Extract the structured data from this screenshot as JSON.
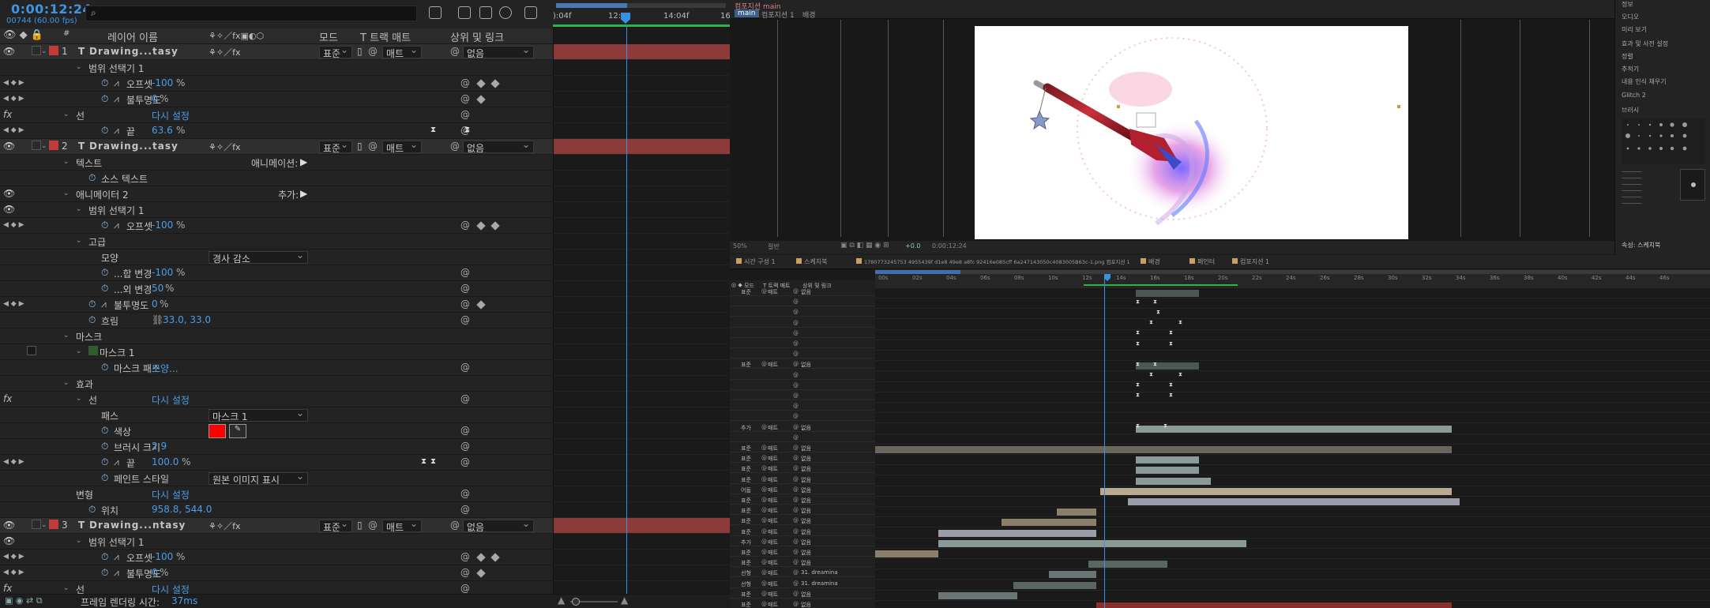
{
  "left": {
    "timecode": "0:00:12:24",
    "fps": "00744 (60.00 fps)",
    "search_placeholder": "",
    "headers": {
      "layer_name": "레이어 이름",
      "mode": "모드",
      "track": "T  트랙 매트",
      "parent": "상위 및 링크"
    },
    "ruler": [
      "):04f",
      "12:04",
      "14:04f",
      "16"
    ],
    "footer_label": "프레임 렌더링 시간:",
    "footer_value": "37ms",
    "rows": [
      {
        "type": "layer",
        "num": "1",
        "name": "Drawing...tasy",
        "mode": "표준",
        "matte": "매트",
        "parent": "없음",
        "color": "#c23b3b"
      },
      {
        "type": "prop",
        "indent": 2,
        "name": "범위 선택기 1"
      },
      {
        "type": "prop",
        "indent": 3,
        "name": "오프셋",
        "value": "-100",
        "unit": "%",
        "stopwatch": true,
        "graph": true,
        "nav": true,
        "kf": [
          608,
          626
        ]
      },
      {
        "type": "prop",
        "indent": 3,
        "name": "불투명도",
        "value": "0",
        "unit": "%",
        "stopwatch": true,
        "graph": true,
        "nav": true,
        "kf": [
          608
        ]
      },
      {
        "type": "prop",
        "indent": 1,
        "name": "선",
        "value": "다시 설정",
        "fx": true
      },
      {
        "type": "prop",
        "indent": 3,
        "name": "끝",
        "value": "63.6",
        "unit": "%",
        "stopwatch": true,
        "graph": true,
        "nav": true,
        "ib": [
          548,
          591
        ]
      },
      {
        "type": "layer",
        "num": "2",
        "name": "Drawing...tasy",
        "mode": "표준",
        "matte": "매트",
        "parent": "없음",
        "color": "#c23b3b"
      },
      {
        "type": "prop",
        "indent": 1,
        "name": "텍스트",
        "value2": "애니메이션:"
      },
      {
        "type": "prop",
        "indent": 2,
        "name": "소스 텍스트",
        "stopwatch": true
      },
      {
        "type": "prop",
        "indent": 1,
        "name": "애니메이터 2",
        "value2": "추가:",
        "eye": true
      },
      {
        "type": "prop",
        "indent": 2,
        "name": "범위 선택기 1",
        "eye": true
      },
      {
        "type": "prop",
        "indent": 3,
        "name": "오프셋",
        "value": "-100",
        "unit": "%",
        "stopwatch": true,
        "graph": true,
        "nav": true,
        "kf": [
          608,
          626
        ]
      },
      {
        "type": "prop",
        "indent": 2,
        "name": "고급"
      },
      {
        "type": "prop",
        "indent": 3,
        "name": "모양",
        "select": "경사 감소"
      },
      {
        "type": "prop",
        "indent": 3,
        "name": "...합 변경",
        "value": "-100",
        "unit": "%",
        "stopwatch": true
      },
      {
        "type": "prop",
        "indent": 3,
        "name": "...외 변경",
        "value": "50",
        "unit": "%",
        "stopwatch": true
      },
      {
        "type": "prop",
        "indent": 2,
        "name": "불투명도",
        "value": "0",
        "unit": "%",
        "stopwatch": true,
        "graph": true,
        "nav": true,
        "kf": [
          608
        ]
      },
      {
        "type": "prop",
        "indent": 2,
        "name": "흐림",
        "value": "33.0, 33.0",
        "stopwatch": true,
        "link": true
      },
      {
        "type": "prop",
        "indent": 1,
        "name": "마스크"
      },
      {
        "type": "prop",
        "indent": 2,
        "name": "마스크 1",
        "maskbox": true
      },
      {
        "type": "prop",
        "indent": 3,
        "name": "마스크 패스",
        "value": "모양...",
        "stopwatch": true
      },
      {
        "type": "prop",
        "indent": 1,
        "name": "효과"
      },
      {
        "type": "prop",
        "indent": 2,
        "name": "선",
        "value": "다시 설정",
        "fx": true
      },
      {
        "type": "prop",
        "indent": 3,
        "name": "패스",
        "select": "마스크 1"
      },
      {
        "type": "prop",
        "indent": 3,
        "name": "색상",
        "swatch": true,
        "stopwatch": true
      },
      {
        "type": "prop",
        "indent": 3,
        "name": "브러시 크기",
        "value": "2.9",
        "stopwatch": true
      },
      {
        "type": "prop",
        "indent": 3,
        "name": "끝",
        "value": "100.0",
        "unit": "%",
        "stopwatch": true,
        "graph": true,
        "nav": true,
        "ib": [
          536,
          548
        ]
      },
      {
        "type": "prop",
        "indent": 3,
        "name": "페인트 스타일",
        "select": "원본 이미지 표시",
        "stopwatch": true
      },
      {
        "type": "prop",
        "indent": 1,
        "name": "변형",
        "value": "다시 설정"
      },
      {
        "type": "prop",
        "indent": 2,
        "name": "위치",
        "value": "958.8, 544.0",
        "stopwatch": true
      },
      {
        "type": "layer",
        "num": "3",
        "name": "Drawing...ntasy",
        "mode": "표준",
        "matte": "매트",
        "parent": "없음",
        "color": "#c23b3b"
      },
      {
        "type": "prop",
        "indent": 2,
        "name": "범위 선택기 1",
        "eye": true
      },
      {
        "type": "prop",
        "indent": 3,
        "name": "오프셋",
        "value": "-100",
        "unit": "%",
        "stopwatch": true,
        "graph": true,
        "nav": true,
        "kf": [
          608,
          626
        ]
      },
      {
        "type": "prop",
        "indent": 3,
        "name": "불투명도",
        "value": "0",
        "unit": "%",
        "stopwatch": true,
        "graph": true,
        "nav": true,
        "kf": [
          608
        ]
      },
      {
        "type": "prop",
        "indent": 1,
        "name": "선",
        "value": "다시 설정",
        "fx": true
      }
    ]
  },
  "comp": {
    "tabs": [
      "컴포지션 main",
      "main",
      "컴포지션 1",
      "배경"
    ],
    "zoom": "50%",
    "res": "절반",
    "timecode": "0:00:12:24",
    "exposure": "+0.0"
  },
  "right_panel": [
    "정보",
    "오디오",
    "미리 보기",
    "효과 및 사전 설정",
    "정렬",
    "추적기",
    "내용 인식 채우기",
    "Glitch 2",
    "브러시",
    "",
    "",
    "",
    "",
    "",
    "",
    "",
    "",
    "",
    "",
    "",
    "",
    "",
    "",
    "",
    "속성: 스케치북"
  ],
  "tl2": {
    "tabs": [
      "시간 구성 1",
      "스케치북",
      "1780773245753 4955439f d1e8 49e8 a8fc 92416e085cff 6a247143050c4083005B63c-1.png 컴포지션 1",
      "배경",
      "페인터",
      "컴포지션 1"
    ],
    "ruler": [
      "00s",
      "02s",
      "04s",
      "06s",
      "08s",
      "10s",
      "12s",
      "14s",
      "16s",
      "18s",
      "20s",
      "22s",
      "24s",
      "26s",
      "28s",
      "30s",
      "32s",
      "34s",
      "36s",
      "38s",
      "40s",
      "42s",
      "44s",
      "46s"
    ],
    "colhdr": {
      "mode": "모드",
      "track": "T 트랙 매트",
      "parent": "상위 및 링크"
    },
    "rows": [
      {
        "mode": "표준",
        "matte": "매트",
        "parent": "없음"
      },
      {
        "mode": "",
        "matte": "",
        "parent": ""
      },
      {
        "mode": "",
        "matte": "",
        "parent": ""
      },
      {
        "mode": "",
        "matte": "",
        "parent": ""
      },
      {
        "mode": "",
        "matte": "",
        "parent": ""
      },
      {
        "mode": "",
        "matte": "",
        "parent": ""
      },
      {
        "mode": "",
        "matte": "",
        "parent": ""
      },
      {
        "mode": "표준",
        "matte": "매트",
        "parent": "없음"
      },
      {
        "mode": "",
        "matte": "",
        "parent": ""
      },
      {
        "mode": "",
        "matte": "",
        "parent": ""
      },
      {
        "mode": "",
        "matte": "",
        "parent": ""
      },
      {
        "mode": "",
        "matte": "",
        "parent": ""
      },
      {
        "mode": "",
        "matte": "",
        "parent": ""
      },
      {
        "mode": "추가",
        "matte": "매트",
        "parent": "없음"
      },
      {
        "mode": "",
        "matte": "",
        "parent": ""
      },
      {
        "mode": "표준",
        "matte": "매트",
        "parent": "없음"
      },
      {
        "mode": "표준",
        "matte": "매트",
        "parent": "없음"
      },
      {
        "mode": "표준",
        "matte": "매트",
        "parent": "없음"
      },
      {
        "mode": "표준",
        "matte": "매트",
        "parent": "없음"
      },
      {
        "mode": "어둡",
        "matte": "매트",
        "parent": "없음"
      },
      {
        "mode": "표준",
        "matte": "매트",
        "parent": "없음"
      },
      {
        "mode": "표준",
        "matte": "매트",
        "parent": "없음"
      },
      {
        "mode": "표준",
        "matte": "매트",
        "parent": "없음"
      },
      {
        "mode": "표준",
        "matte": "매트",
        "parent": "없음"
      },
      {
        "mode": "추가",
        "matte": "매트",
        "parent": "없음"
      },
      {
        "mode": "표준",
        "matte": "매트",
        "parent": "없음"
      },
      {
        "mode": "표준",
        "matte": "매트",
        "parent": "없음"
      },
      {
        "mode": "선형",
        "matte": "매트",
        "parent": "31. dreamina"
      },
      {
        "mode": "선형",
        "matte": "매트",
        "parent": "31. dreamina"
      },
      {
        "mode": "표준",
        "matte": "매트",
        "parent": "없음"
      },
      {
        "mode": "표준",
        "matte": "매트",
        "parent": "없음"
      }
    ]
  }
}
